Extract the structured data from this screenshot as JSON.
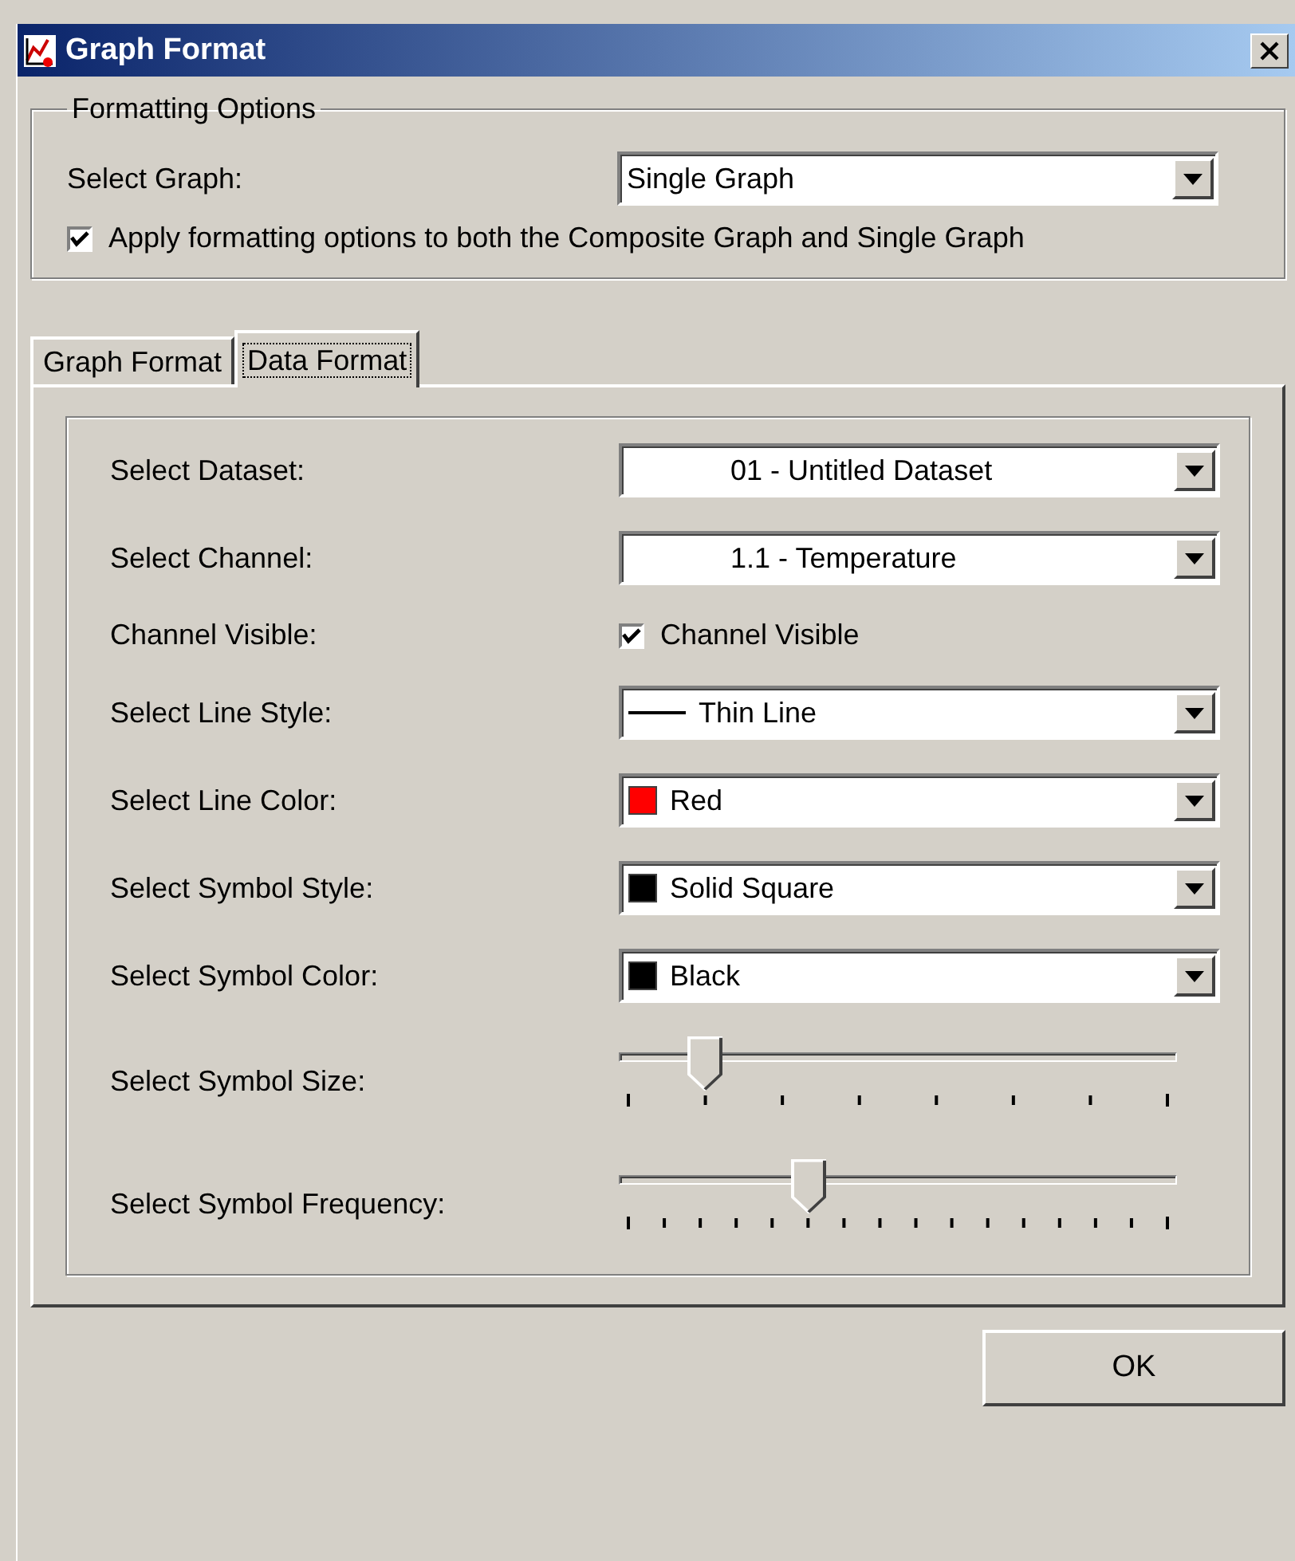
{
  "window": {
    "title": "Graph Format"
  },
  "formatting_options": {
    "legend": "Formatting Options",
    "select_graph": {
      "label": "Select Graph:",
      "value": "Single Graph"
    },
    "apply_both": {
      "label": "Apply formatting options to both the Composite Graph and Single Graph",
      "checked": true
    }
  },
  "tabs": [
    {
      "label": "Graph Format",
      "selected": false
    },
    {
      "label": "Data Format",
      "selected": true
    }
  ],
  "data_format": [
    {
      "kind": "combo",
      "label": "Select Dataset:",
      "value": "01 - Untitled Dataset"
    },
    {
      "kind": "combo",
      "label": "Select Channel:",
      "value": "1.1 - Temperature"
    },
    {
      "kind": "checkbox",
      "label": "Channel Visible:",
      "text": "Channel Visible",
      "checked": true
    },
    {
      "kind": "combo",
      "label": "Select Line Style:",
      "value": "Thin Line",
      "line_sample": true
    },
    {
      "kind": "combo",
      "label": "Select Line Color:",
      "value": "Red",
      "color": "#ff0000"
    },
    {
      "kind": "combo",
      "label": "Select Symbol Style:",
      "value": "Solid Square",
      "color": "#000000"
    },
    {
      "kind": "combo",
      "label": "Select Symbol Color:",
      "value": "Black",
      "color": "#000000"
    },
    {
      "kind": "slider",
      "label": "Select Symbol Size:",
      "level": 0.143
    },
    {
      "kind": "slider",
      "label": "Select Symbol Frequency:",
      "level": 0.333
    }
  ],
  "buttons": [
    "OK"
  ]
}
